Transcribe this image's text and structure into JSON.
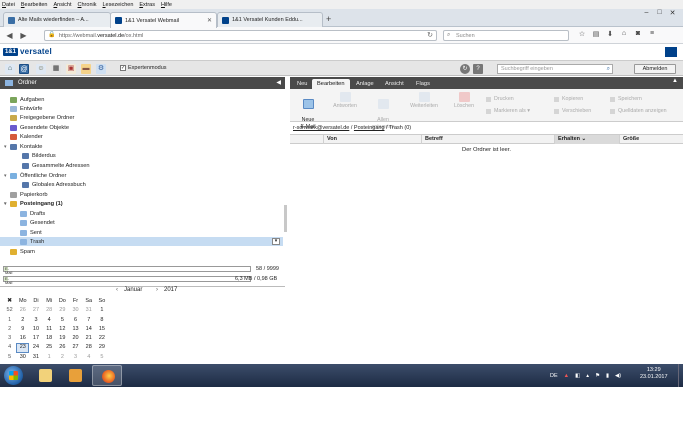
{
  "menu": [
    "Datei",
    "Bearbeiten",
    "Ansicht",
    "Chronik",
    "Lesezeichen",
    "Extras",
    "Hilfe"
  ],
  "tabs": [
    {
      "label": "Alte Mails wiederfinden – A...",
      "color": "#3a6ea5",
      "active": false
    },
    {
      "label": "1&1 Versatel Webmail",
      "color": "#00418a",
      "active": true
    },
    {
      "label": "1&1 Versatel Kunden Eddu...",
      "color": "#00418a",
      "active": false
    }
  ],
  "urlbar": {
    "prefix": "https://webmail.",
    "host": "versatel.de",
    "suffix": "/ox.html"
  },
  "searchbar": {
    "placeholder": "Suchen"
  },
  "brand": {
    "box": "1&1",
    "word": "versatel"
  },
  "toolbar": {
    "expert_label": "Expertenmodus",
    "search_placeholder": "Suchbegriff eingeben",
    "logout_label": "Abmelden",
    "help_label": "?"
  },
  "left": {
    "header": "Ordner",
    "folders": [
      {
        "label": "Aufgaben",
        "color": "#7ba55b"
      },
      {
        "label": "Entwürfe",
        "color": "#9bb8d8"
      },
      {
        "label": "Freigegebene Ordner",
        "color": "#c9a94a"
      },
      {
        "label": "Gesendete Objekte",
        "color": "#6a5acd"
      },
      {
        "label": "Kalender",
        "color": "#d65a3a"
      },
      {
        "label": "Kontakte",
        "color": "#5577aa"
      },
      {
        "label": "Bilderdus",
        "color": "#5577aa"
      },
      {
        "label": "Gesammelte Adressen",
        "color": "#5577aa"
      },
      {
        "label": "Öffentliche Ordner",
        "color": "#7ab0e0"
      },
      {
        "label": "Globales Adressbuch",
        "color": "#5577aa"
      },
      {
        "label": "Papierkorb",
        "color": "#a0a0a0"
      },
      {
        "label": "Posteingang (1)",
        "color": "#e0b030"
      },
      {
        "label": "Drafts",
        "color": "#8cb4e0"
      },
      {
        "label": "Gesendet",
        "color": "#8cb4e0"
      },
      {
        "label": "Sent",
        "color": "#8cb4e0"
      },
      {
        "label": "Trash",
        "color": "#8cb4e0"
      },
      {
        "label": "Spam",
        "color": "#e0b030"
      }
    ],
    "quota": [
      {
        "label": "E-Mail",
        "value": "58 / 9999",
        "fraction": 0.006
      },
      {
        "label": "E-Mail",
        "value": "6,3 MB / 0,98 GB",
        "fraction": 0.006
      }
    ]
  },
  "calendar": {
    "month": "Januar",
    "year": "2017",
    "prev": "‹",
    "next": "›",
    "weekday_headers": [
      "",
      "Mo",
      "Di",
      "Mi",
      "Do",
      "Fr",
      "Sa",
      "So"
    ],
    "rows": [
      [
        "52",
        "26",
        "27",
        "28",
        "29",
        "30",
        "31",
        "1"
      ],
      [
        "1",
        "2",
        "3",
        "4",
        "5",
        "6",
        "7",
        "8"
      ],
      [
        "2",
        "9",
        "10",
        "11",
        "12",
        "13",
        "14",
        "15"
      ],
      [
        "3",
        "16",
        "17",
        "18",
        "19",
        "20",
        "21",
        "22"
      ],
      [
        "4",
        "23",
        "24",
        "25",
        "26",
        "27",
        "28",
        "29"
      ],
      [
        "5",
        "30",
        "31",
        "1",
        "2",
        "3",
        "4",
        "5"
      ]
    ],
    "today": "23"
  },
  "right": {
    "tabs": [
      "Neu",
      "Bearbeiten",
      "Anlage",
      "Ansicht",
      "Flags"
    ],
    "ribbon": {
      "new_email": "Neue\nE-Mail",
      "reply": "Antworten",
      "reply_all": "Allen\nantworten",
      "forward": "Weiterleiten",
      "delete": "Löschen",
      "print": "Drucken",
      "mark_as": "Markieren als ▾",
      "copy": "Kopieren",
      "move": "Verschieben",
      "save": "Speichern",
      "source": "Quelldaten anzeigen"
    },
    "breadcrumb": {
      "account": "r-schwark@versatel.de",
      "sep": " / ",
      "inbox": "Posteingang",
      "rest": " / Trash (0)"
    },
    "columns": [
      "Von",
      "Betreff",
      "Erhalten ⌄",
      "Größe"
    ],
    "empty_message": "Der Ordner ist leer."
  },
  "taskbar": {
    "lang": "DE",
    "time": "13:29",
    "date": "23.01.2017"
  }
}
